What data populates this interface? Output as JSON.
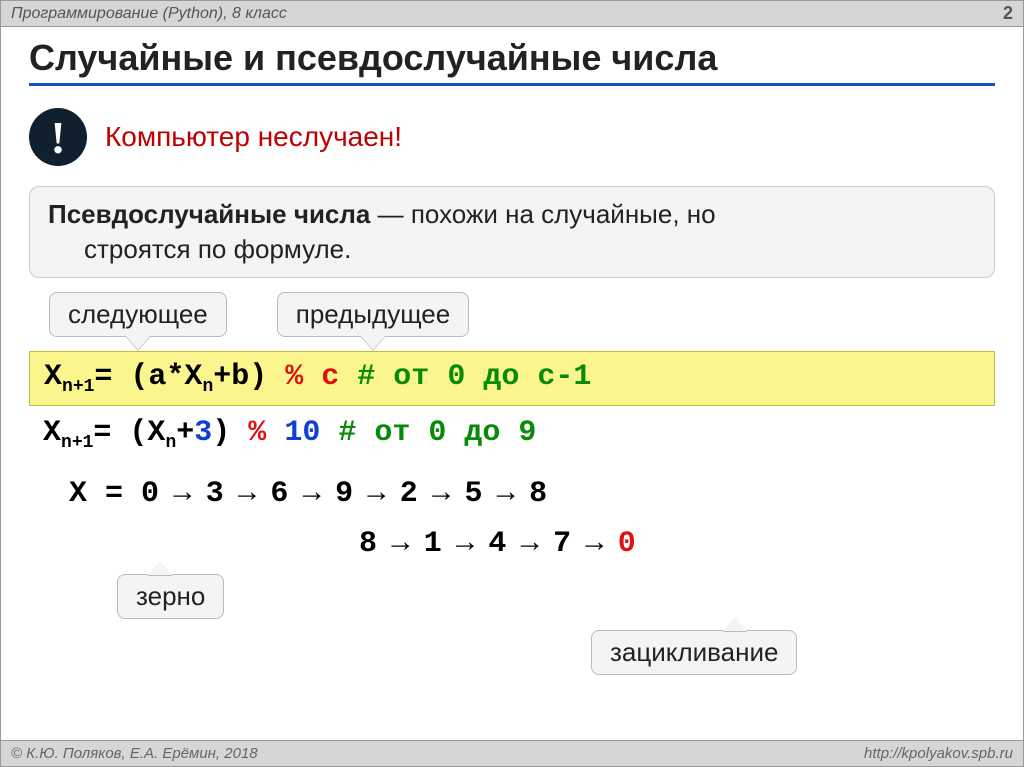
{
  "meta": {
    "course": "Программирование (Python), 8 класс",
    "page": "2",
    "title": "Случайные и псевдослучайные числа"
  },
  "alert": {
    "text": "Компьютер неслучаен!"
  },
  "definition": {
    "term": "Псевдослучайные числа",
    "rest1": " — похожи на случайные, но",
    "rest2": "строятся по формуле."
  },
  "callouts": {
    "next": "следующее",
    "prev": "предыдущее",
    "seed": "зерно",
    "loop": "зацикливание"
  },
  "formulas": {
    "general": {
      "lhs_x": "X",
      "lhs_sub": "n+1",
      "eq": "= (a*X",
      "mid_sub": "n",
      "after": "+b) ",
      "pct": "% c",
      "comment": " # от 0 до c-1"
    },
    "example": {
      "lhs_x": "X",
      "lhs_sub": "n+1",
      "eq": "= (X",
      "mid_sub": "n",
      "plus": "+",
      "three": "3",
      "rp": ") ",
      "pct": "% ",
      "ten": "10",
      "hash": "  #  ",
      "comment": "от 0 до 9"
    }
  },
  "sequence": {
    "label": "X = ",
    "vals": [
      "0",
      "3",
      "6",
      "9",
      "2",
      "5",
      "8"
    ],
    "cont": [
      "8",
      "1",
      "4",
      "7",
      "0"
    ],
    "arrow": " → "
  },
  "footer": {
    "copyright": "© К.Ю. Поляков, Е.А. Ерёмин, 2018",
    "url": "http://kpolyakov.spb.ru"
  }
}
